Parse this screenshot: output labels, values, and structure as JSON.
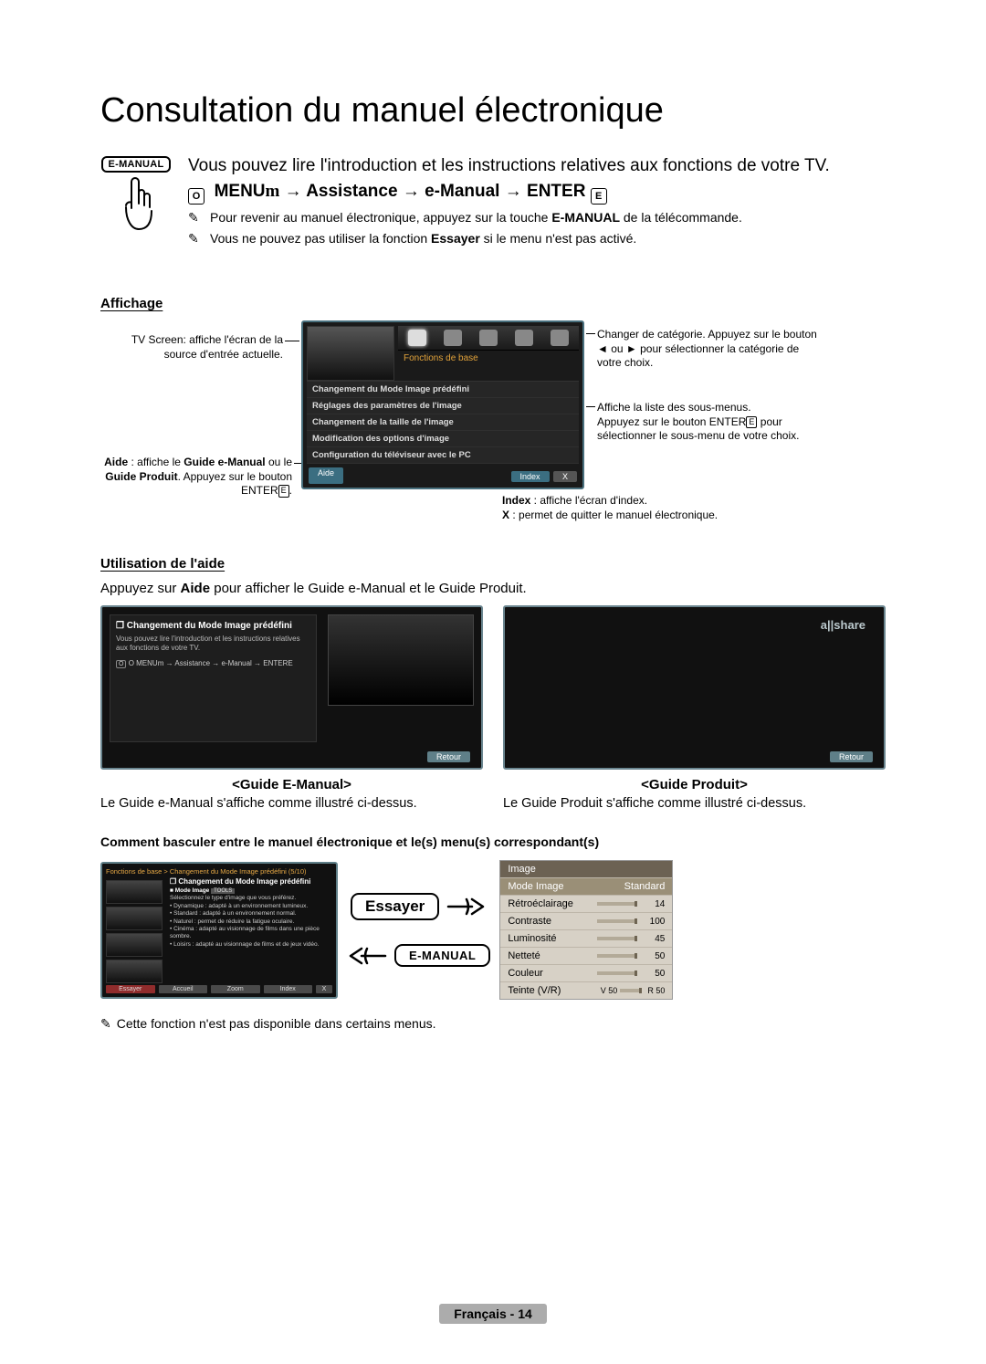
{
  "title": "Consultation du manuel électronique",
  "badge": "E-MANUAL",
  "intro": "Vous pouvez lire l'introduction et les instructions relatives aux fonctions de votre TV.",
  "nav": {
    "osd": "O",
    "menu": "MENU",
    "m": "m",
    "a": "Assistance",
    "b": "e-Manual",
    "enter": "ENTER",
    "e": "E"
  },
  "note1_pre": "Pour revenir au manuel électronique, appuyez sur la touche ",
  "note1_bold": "E-MANUAL",
  "note1_post": " de la télécommande.",
  "note2_pre": "Vous ne pouvez pas utiliser la fonction ",
  "note2_bold": "Essayer",
  "note2_post": " si le menu n'est pas activé.",
  "affichage_head": "Affichage",
  "ann": {
    "tv_screen": "TV Screen: affiche l'écran de la source d'entrée actuelle.",
    "aide_pre": "Aide",
    "aide_mid": " : affiche le ",
    "aide_b1": "Guide e-Manual",
    "aide_mid2": " ou le ",
    "aide_b2": "Guide Produit",
    "aide_post": ". Appuyez sur le bouton ENTER",
    "aide_e": "E",
    "aide_dot": ".",
    "cat": "Changer de catégorie. Appuyez sur le bouton ◄ ou ► pour sélectionner la catégorie de votre choix.",
    "sub_a": "Affiche la liste des sous-menus.",
    "sub_b": "Appuyez sur le bouton ENTER",
    "sub_e": "E",
    "sub_c": " pour sélectionner le sous-menu de votre choix.",
    "index_b": "Index",
    "index_t": " : affiche l'écran d'index.",
    "x_b": "X",
    "x_t": " : permet de quitter le manuel électronique."
  },
  "tv": {
    "cat": "Fonctions de base",
    "rows": [
      "Changement du Mode Image prédéfini",
      "Réglages des paramètres de l'image",
      "Changement de la taille de l'image",
      "Modification des options d'image",
      "Configuration du téléviseur avec le PC"
    ],
    "aide": "Aide",
    "index": "Index",
    "x": "X"
  },
  "util_head": "Utilisation de l'aide",
  "util_desc_pre": "Appuyez sur ",
  "util_desc_bold": "Aide",
  "util_desc_post": " pour afficher le Guide e-Manual et le Guide Produit.",
  "g1": {
    "title": "Changement du Mode Image prédéfini",
    "sub": "Vous pouvez lire l'introduction et les instructions relatives aux fonctions de votre TV.",
    "nav": "O MENUm → Assistance → e-Manual → ENTERE",
    "retour": "Retour",
    "label": "<Guide E-Manual>",
    "desc": "Le Guide e-Manual s'affiche comme illustré ci-dessus."
  },
  "g2": {
    "logo": "a||share",
    "retour": "Retour",
    "label": "<Guide Produit>",
    "desc": "Le Guide Produit s'affiche comme illustré ci-dessus."
  },
  "bascule_head": "Comment basculer entre le manuel électronique et le(s) menu(s) correspondant(s)",
  "em": {
    "crumb": "Fonctions de base > Changement du Mode Image prédéfini (5/10)",
    "ct": "Changement du Mode Image prédéfini",
    "mode": "Mode Image",
    "body": "Sélectionnez le type d'image que vous préférez.",
    "bullets": [
      "Dynamique : adapté à un environnement lumineux.",
      "Standard : adapté à un environnement normal.",
      "Naturel : permet de réduire la fatigue oculaire.",
      "Cinéma : adapté au visionnage de films dans une pièce sombre.",
      "Loisirs : adapté au visionnage de films et de jeux vidéo."
    ],
    "b1": "Essayer",
    "b2": "Accueil",
    "b3": "Zoom",
    "b4": "Index",
    "b5": "X"
  },
  "pill_try": "Essayer",
  "pill_em": "E-MANUAL",
  "osd": {
    "head": "Image",
    "hi_l": "Mode Image",
    "hi_r": "Standard",
    "rows": [
      {
        "l": "Rétroéclairage",
        "v": "14"
      },
      {
        "l": "Contraste",
        "v": "100"
      },
      {
        "l": "Luminosité",
        "v": "45"
      },
      {
        "l": "Netteté",
        "v": "50"
      },
      {
        "l": "Couleur",
        "v": "50"
      }
    ],
    "tint_l": "Teinte (V/R)",
    "tint_v": "V 50",
    "tint_r": "R 50"
  },
  "final_note": "Cette fonction n'est pas disponible dans certains menus.",
  "footer": "Français - 14"
}
